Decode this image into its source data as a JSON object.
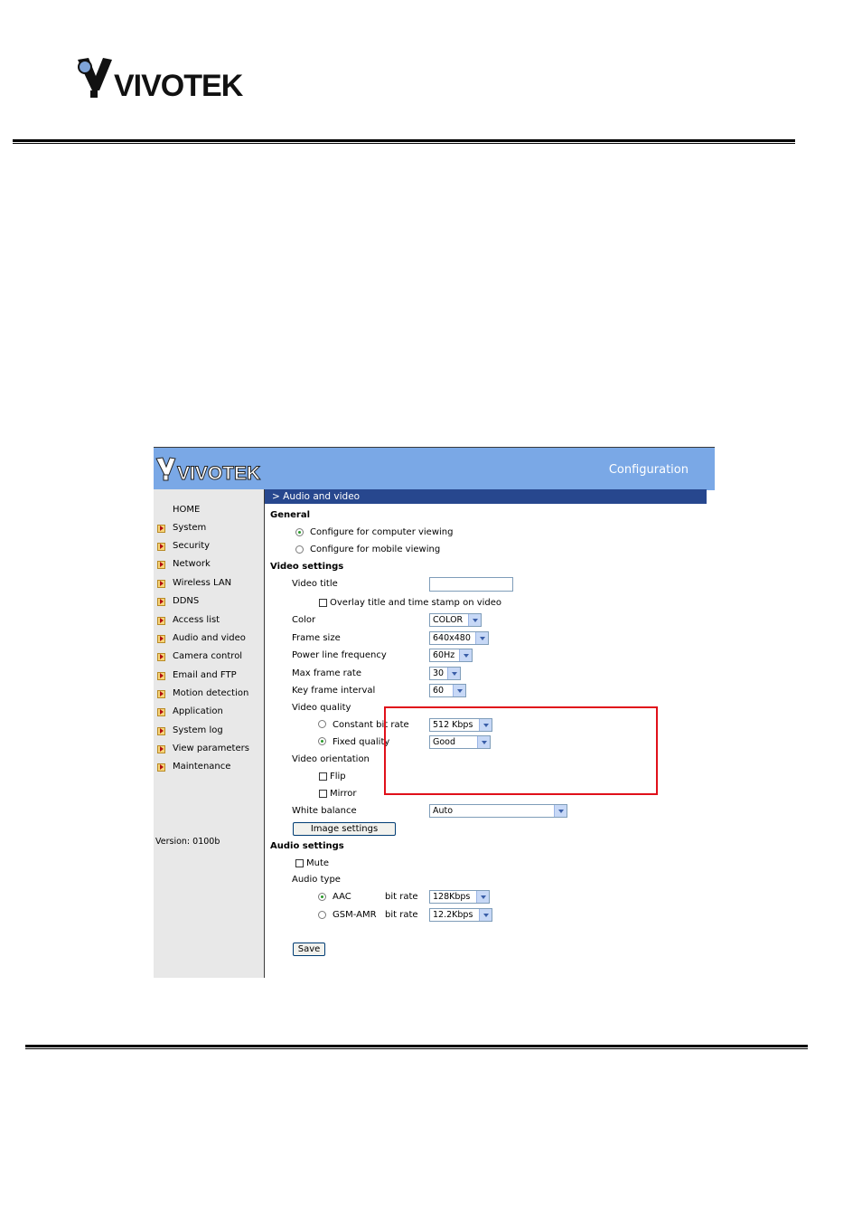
{
  "doc": {
    "logo_text": "VIVOTEK"
  },
  "screenshot": {
    "header": {
      "logo_text": "VIVOTEK",
      "config_title": "Configuration"
    },
    "sidebar": {
      "home": "HOME",
      "items": [
        {
          "label": "System"
        },
        {
          "label": "Security"
        },
        {
          "label": "Network"
        },
        {
          "label": "Wireless LAN"
        },
        {
          "label": "DDNS"
        },
        {
          "label": "Access list"
        },
        {
          "label": "Audio and video"
        },
        {
          "label": "Camera control"
        },
        {
          "label": "Email and FTP"
        },
        {
          "label": "Motion detection"
        },
        {
          "label": "Application"
        },
        {
          "label": "System log"
        },
        {
          "label": "View parameters"
        },
        {
          "label": "Maintenance"
        }
      ],
      "version": "Version: 0100b"
    },
    "section_title": "> Audio and video",
    "general": {
      "heading": "General",
      "option_computer": "Configure for computer viewing",
      "option_mobile": "Configure for mobile viewing",
      "selected": "computer"
    },
    "video": {
      "heading": "Video settings",
      "title_label": "Video title",
      "title_value": "",
      "overlay_label": "Overlay title and time stamp on video",
      "overlay_checked": false,
      "color_label": "Color",
      "color_value": "COLOR",
      "frame_size_label": "Frame size",
      "frame_size_value": "640x480",
      "power_line_label": "Power line frequency",
      "power_line_value": "60Hz",
      "max_frame_rate_label": "Max frame rate",
      "max_frame_rate_value": "30",
      "key_frame_label": "Key frame interval",
      "key_frame_value": "60",
      "quality_label": "Video quality",
      "constant_bit_rate_label": "Constant bit rate",
      "constant_bit_rate_value": "512 Kbps",
      "fixed_quality_label": "Fixed quality",
      "fixed_quality_value": "Good",
      "quality_selected": "fixed",
      "orientation_label": "Video orientation",
      "flip_label": "Flip",
      "mirror_label": "Mirror",
      "white_balance_label": "White balance",
      "white_balance_value": "Auto",
      "image_settings_button": "Image settings"
    },
    "audio": {
      "heading": "Audio settings",
      "mute_label": "Mute",
      "type_label": "Audio type",
      "aac_label": "AAC",
      "aac_bitrate_label": "bit rate",
      "aac_bitrate_value": "128Kbps",
      "gsm_label": "GSM-AMR",
      "gsm_bitrate_label": "bit rate",
      "gsm_bitrate_value": "12.2Kbps",
      "selected": "aac"
    },
    "save_button": "Save",
    "colors": {
      "header_bg": "#7aa8e6",
      "section_bar": "#27478e",
      "highlight_box": "#e0101a"
    }
  }
}
